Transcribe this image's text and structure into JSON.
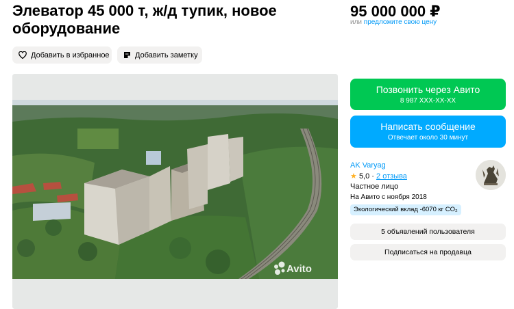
{
  "listing": {
    "title": "Элеватор 45 000 т, ж/д тупик, новое оборудование",
    "price": "95 000 000 ₽",
    "price_prefix": "или",
    "offer_price_link": "предложите свою цену"
  },
  "actions": {
    "favorite_label": "Добавить в избранное",
    "note_label": "Добавить заметку"
  },
  "gallery": {
    "watermark": "Avito"
  },
  "contact": {
    "call_label": "Позвонить через Авито",
    "call_phone": "8 987 XXX-XX-XX",
    "message_label": "Написать сообщение",
    "message_sub": "Отвечает около 30 минут"
  },
  "seller": {
    "name": "AK Varyag",
    "rating": "5,0",
    "reviews": "2 отзыва",
    "type": "Частное лицо",
    "since": "На Авито с ноября 2018",
    "eco_badge": "Экологический вклад -6070 кг CO₂",
    "ads_button": "5 объявлений пользователя",
    "subscribe_button": "Подписаться на продавца"
  },
  "colors": {
    "call_green": "#00c853",
    "message_blue": "#00aaff",
    "link_blue": "#0099f7",
    "star_yellow": "#ffb021"
  },
  "icons": [
    "heart-icon",
    "note-icon",
    "star-icon",
    "avito-logo-icon"
  ]
}
